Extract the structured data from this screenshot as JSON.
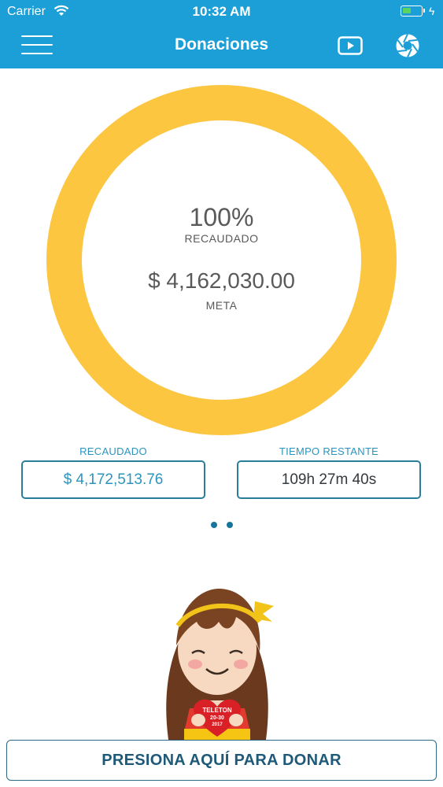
{
  "status_bar": {
    "carrier": "Carrier",
    "time": "10:32 AM",
    "battery_level": 0.45
  },
  "header": {
    "title": "Donaciones"
  },
  "progress": {
    "percent_text": "100%",
    "percent_label": "RECAUDADO",
    "goal_amount": "$ 4,162,030.00",
    "goal_label": "META",
    "fraction": 1.0,
    "ring_color": "#fcc641"
  },
  "stats": {
    "raised_label": "RECAUDADO",
    "raised_value": "$ 4,172,513.76",
    "time_label": "TIEMPO RESTANTE",
    "time_value": "109h 27m 40s"
  },
  "pager": {
    "count": 2,
    "active_index": 0
  },
  "mascot": {
    "badge_line1": "TELETON",
    "badge_line2": "20-30",
    "badge_line3": "2017"
  },
  "cta": {
    "label": "PRESIONA AQUÍ PARA DONAR"
  },
  "colors": {
    "brand_blue": "#1b9fd6",
    "accent_text": "#2b95bf",
    "dot_color": "#17759d"
  }
}
